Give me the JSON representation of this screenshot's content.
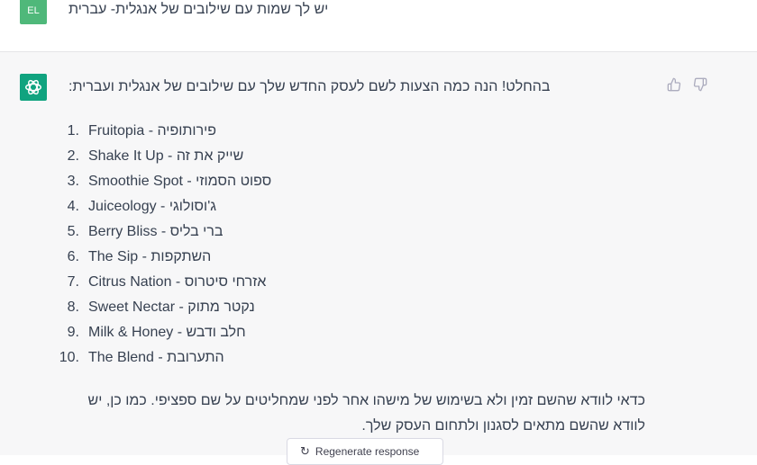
{
  "user_message": {
    "avatar_initials": "EL",
    "text": "יש לך שמות עם שילובים של אנגלית- עברית"
  },
  "assistant_message": {
    "intro": "בהחלט! הנה כמה הצעות לשם לעסק החדש שלך עם שילובים של אנגלית ועברית:",
    "items": [
      {
        "num": "1.",
        "text": "Fruitopia - פירותופיה"
      },
      {
        "num": "2.",
        "text": "Shake It Up - שייק את זה"
      },
      {
        "num": "3.",
        "text": "Smoothie Spot - ספוט הסמוזי"
      },
      {
        "num": "4.",
        "text": "Juiceology - ג'וסולוגי"
      },
      {
        "num": "5.",
        "text": "Berry Bliss - ברי בליס"
      },
      {
        "num": "6.",
        "text": "The Sip - השתקפות"
      },
      {
        "num": "7.",
        "text": "Citrus Nation - אזרחי סיטרוס"
      },
      {
        "num": "8.",
        "text": "Sweet Nectar - נקטר מתוק"
      },
      {
        "num": "9.",
        "text": "Milk & Honey - חלב ודבש"
      },
      {
        "num": "10.",
        "text": "The Blend - התערובת"
      }
    ],
    "note": "כדאי לוודא שהשם זמין ולא בשימוש של מישהו אחר לפני שמחליטים על שם ספציפי. כמו כן, יש לוודא שהשם מתאים לסגנון ולתחום העסק שלך."
  },
  "actions": {
    "thumbs_up": "thumbs-up-icon",
    "thumbs_down": "thumbs-down-icon",
    "regenerate_label": "Regenerate response"
  },
  "colors": {
    "user_avatar": "#4fb87a",
    "bot_avatar": "#10a37f",
    "assistant_bg": "#f7f7f8"
  }
}
